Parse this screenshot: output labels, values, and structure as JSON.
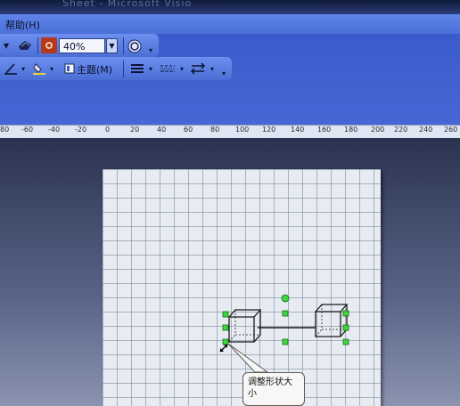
{
  "window": {
    "title": "Sheet - Microsoft Visio"
  },
  "menu": {
    "help_label": "帮助(H)"
  },
  "toolbar_standard": {
    "zoom_value": "40%",
    "icons": [
      "dropdown-arrow-icon",
      "print-preview-icon",
      "zoom-target-icon",
      "zoom-dropdown-arrow-icon",
      "help-icon",
      "toolbar-options-icon"
    ]
  },
  "toolbar_formatting": {
    "theme_label": "主题(M)",
    "icons": [
      "line-color-icon",
      "fill-color-icon",
      "theme-icon",
      "line-weight-icon",
      "line-pattern-icon",
      "line-ends-icon",
      "toolbar-options-icon"
    ]
  },
  "ruler": {
    "labels": [
      "80",
      "-60",
      "-40",
      "-20",
      "0",
      "20",
      "40",
      "60",
      "80",
      "100",
      "120",
      "140",
      "160",
      "180",
      "200",
      "220",
      "240",
      "260"
    ]
  },
  "diagram": {
    "callout_text": "调整形状大小",
    "shapes": [
      "cube-left",
      "cube-right",
      "connector-line"
    ]
  }
}
